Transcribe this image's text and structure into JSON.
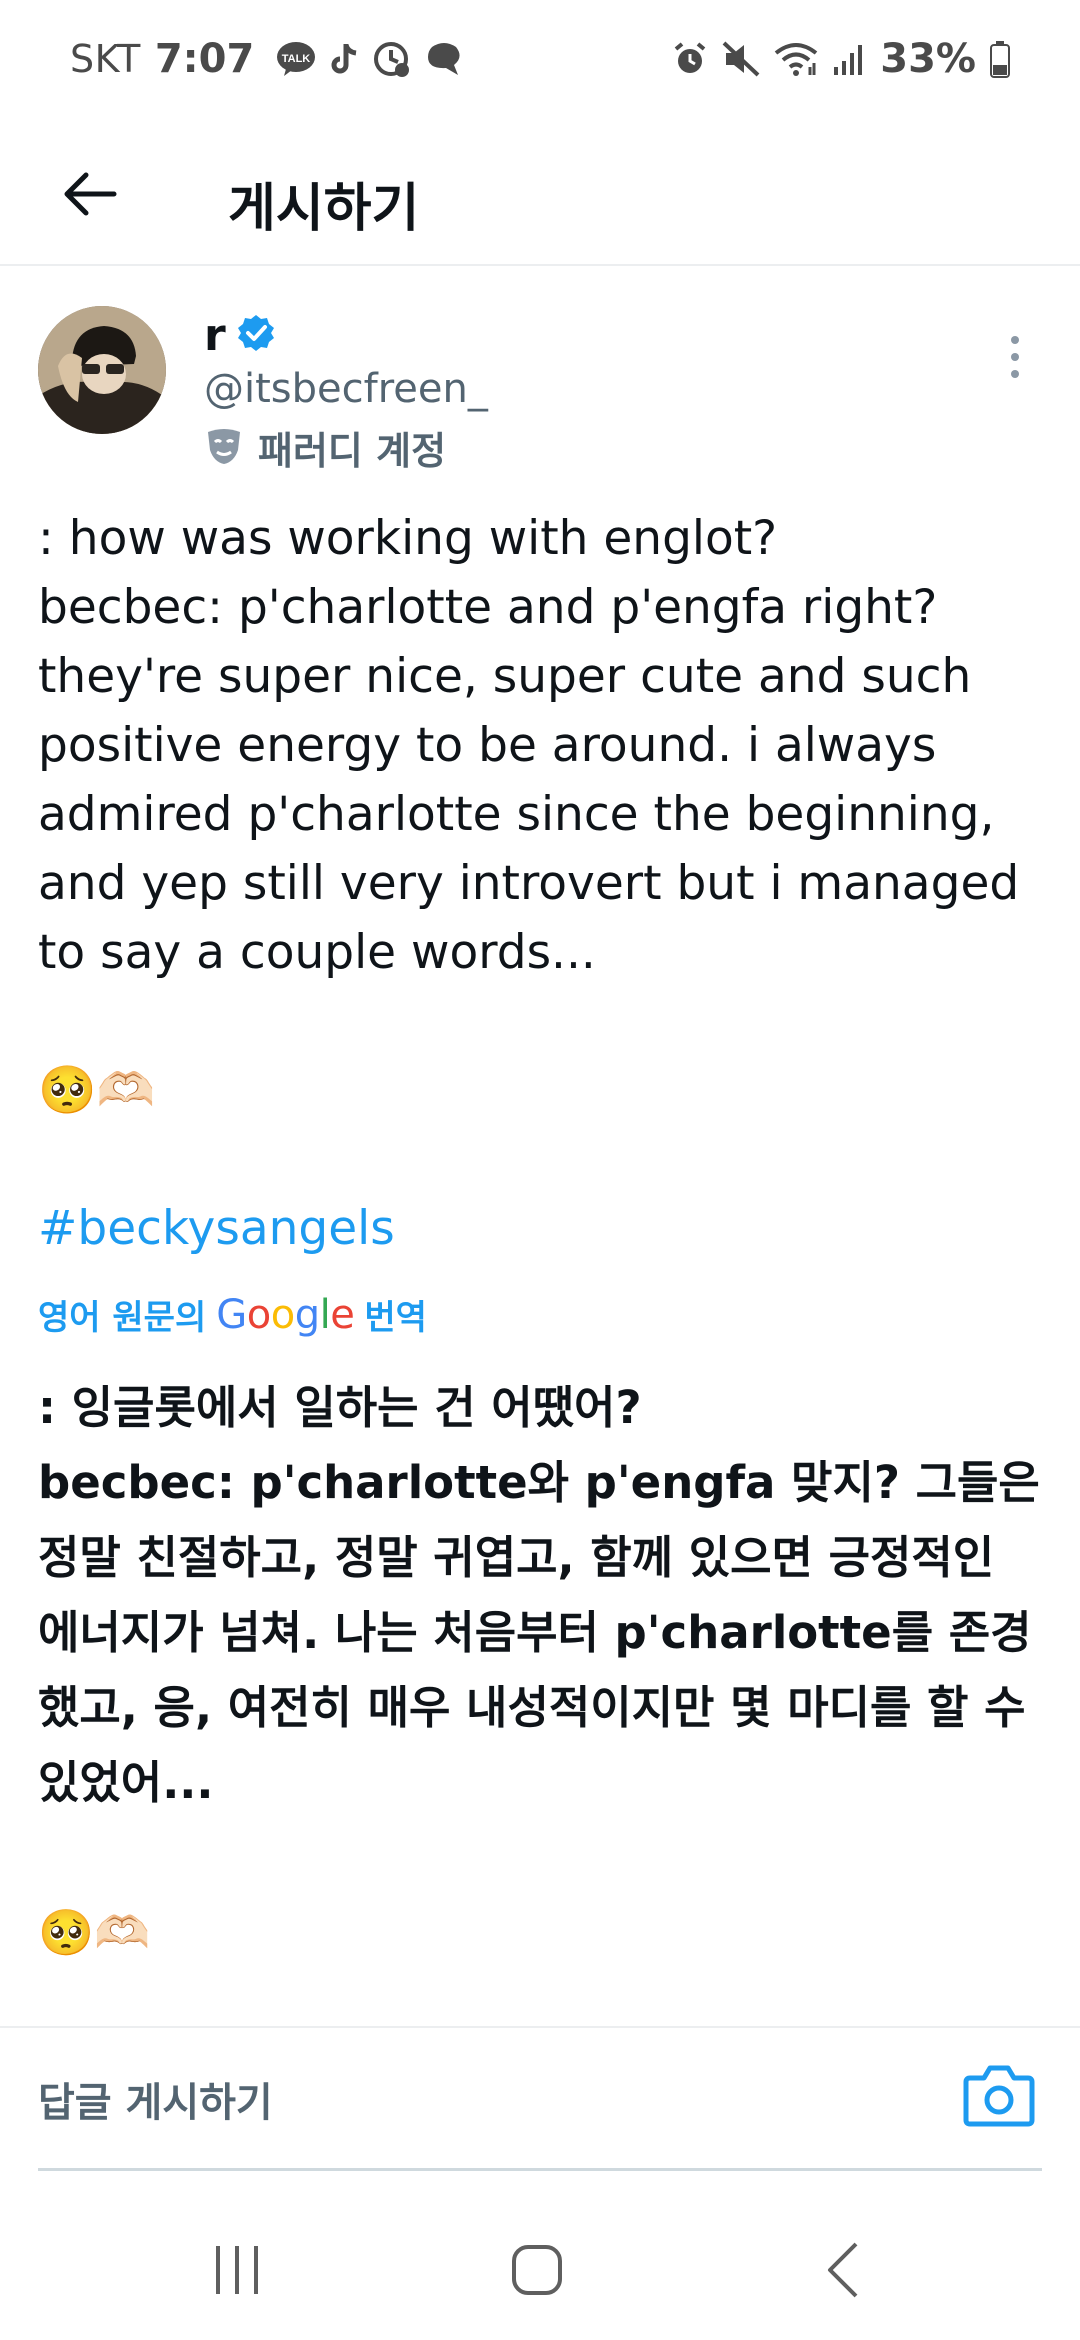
{
  "status_bar": {
    "carrier": "SKT",
    "time": "7:07",
    "battery": "33%",
    "left_icons": [
      "kakaotalk-icon",
      "tiktok-icon",
      "clock-sync-icon",
      "chat-bubble-icon"
    ],
    "right_icons": [
      "alarm-icon",
      "mute-icon",
      "wifi-icon",
      "signal-icon",
      "battery-icon"
    ]
  },
  "app_bar": {
    "title": "게시하기"
  },
  "tweet": {
    "author_name": "r",
    "handle": "@itsbecfreen_",
    "parody_label": "패러디 계정",
    "text": ": how was working with englot?\nbecbec: p'charlotte and p'engfa right? they're super nice, super cute and such positive energy to be around. i always admired p'charlotte since the beginning, and yep still very introvert but i managed to say a couple words...",
    "emoji": "🥺🫶🏻",
    "hashtag": "#beckysangels",
    "translate_prefix": "영어 원문의",
    "translate_brand": "Google",
    "translate_suffix": "번역",
    "translated_text": ": 잉글롯에서 일하는 건 어땠어?\nbecbec: p'charlotte와 p'engfa 맞지? 그들은 정말 친절하고, 정말 귀엽고, 함께 있으면 긍정적인 에너지가 넘쳐. 나는 처음부터 p'charlotte를 존경했고, 응, 여전히 매우 내성적이지만 몇 마디를 할 수 있었어...",
    "translated_emoji": "🥺🫶🏻"
  },
  "reply": {
    "placeholder": "답글 게시하기"
  },
  "colors": {
    "accent": "#1d9bf0",
    "text": "#0f1419",
    "secondary": "#536471",
    "verified": "#1d9bf0"
  }
}
